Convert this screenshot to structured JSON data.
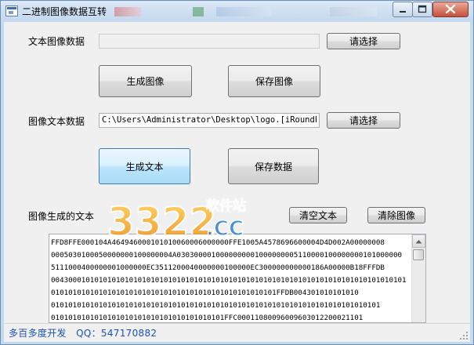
{
  "window": {
    "title": "二进制图像数据互转",
    "controls": {
      "minimize": "minimize-icon",
      "maximize": "maximize-icon",
      "close": "close-icon"
    }
  },
  "text_image": {
    "label": "文本图像数据",
    "value": "",
    "browse_label": "请选择"
  },
  "actions_top": {
    "generate_image": "生成图像",
    "save_image": "保存图像"
  },
  "image_text": {
    "label": "图像文本数据",
    "value": "C:\\Users\\Administrator\\Desktop\\logo.[iRoundPicture]",
    "browse_label": "请选择"
  },
  "actions_mid": {
    "generate_text": "生成文本",
    "save_data": "保存数据"
  },
  "output": {
    "label": "图像生成的文本",
    "clear_text": "清空文本",
    "clear_image": "清除图像",
    "lines": [
      "FFD8FFE000104A464946000101010060006000000FFE1005A4578696600004D4D002A00000008",
      "0005030100050000000100000004A0303000010000000001000000005110000100000000101000000",
      "5111000400000001000000EC3511200040000000100000EC300000000000186A00000B18FFFDB",
      "0043000101010101010101010101010101010101010101010101010101010101010101010101010101",
      "0101010101010101010101010101010101010101010101010101FFDB004301010101010",
      "0101010101010101010101010101010101010101010101010101010101010101010101010101",
      "0101010101010101010101010101010101010101FFC00011080096009603012200021101"
    ]
  },
  "status": {
    "text": "多百多度开发   QQ：547170882"
  },
  "watermark": {
    "brand": "3322.CC",
    "tagline": "软件站"
  },
  "colors": {
    "status_text": "#1a52b8",
    "hot_button": "#bee6fd",
    "titlebar": "#c3d8ee"
  }
}
